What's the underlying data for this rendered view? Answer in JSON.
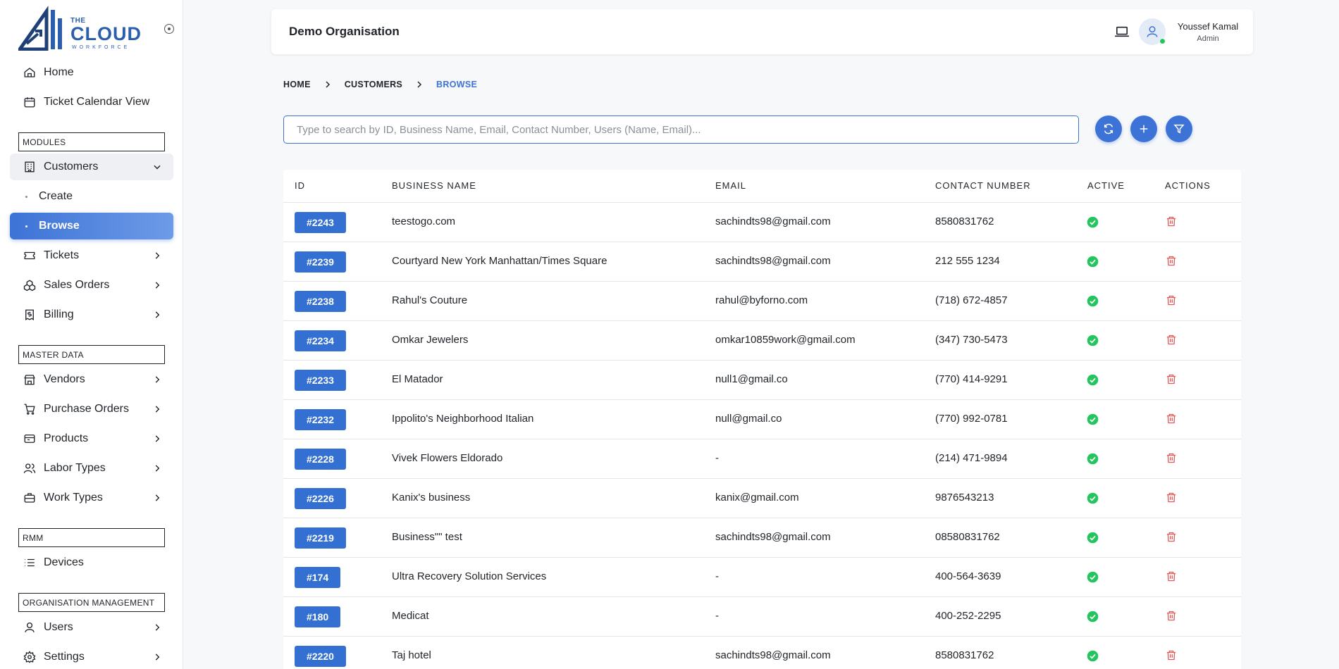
{
  "brand": {
    "top": "THE",
    "main": "CLOUD",
    "sub": "WORKFORCE"
  },
  "sidebar": {
    "items": [
      {
        "label": "Home",
        "icon": "home-icon"
      },
      {
        "label": "Ticket Calendar View",
        "icon": "calendar-icon"
      }
    ],
    "sections": [
      {
        "label": "MODULES"
      },
      {
        "label": "MASTER DATA"
      },
      {
        "label": "RMM"
      },
      {
        "label": "ORGANISATION MANAGEMENT"
      }
    ],
    "modules": [
      {
        "label": "Customers",
        "icon": "building-icon"
      },
      {
        "label": "Create"
      },
      {
        "label": "Browse"
      },
      {
        "label": "Tickets",
        "icon": "ticket-icon"
      },
      {
        "label": "Sales Orders",
        "icon": "boxes-icon"
      },
      {
        "label": "Billing",
        "icon": "receipt-icon"
      }
    ],
    "master_data": [
      {
        "label": "Vendors",
        "icon": "store-icon"
      },
      {
        "label": "Purchase Orders",
        "icon": "cart-icon"
      },
      {
        "label": "Products",
        "icon": "package-icon"
      },
      {
        "label": "Labor Types",
        "icon": "users-icon"
      },
      {
        "label": "Work Types",
        "icon": "briefcase-icon"
      }
    ],
    "rmm": [
      {
        "label": "Devices",
        "icon": "list-icon"
      }
    ],
    "org": [
      {
        "label": "Users",
        "icon": "user-icon"
      },
      {
        "label": "Settings",
        "icon": "gear-icon"
      }
    ]
  },
  "header": {
    "org_name": "Demo Organisation",
    "user_name": "Youssef Kamal",
    "user_role": "Admin"
  },
  "breadcrumb": [
    "HOME",
    "CUSTOMERS",
    "BROWSE"
  ],
  "search": {
    "placeholder": "Type to search by ID, Business Name, Email, Contact Number, Users (Name, Email)...",
    "value": ""
  },
  "table": {
    "columns": [
      "ID",
      "BUSINESS NAME",
      "EMAIL",
      "CONTACT NUMBER",
      "ACTIVE",
      "ACTIONS"
    ],
    "rows": [
      {
        "id": "#2243",
        "name": "teestogo.com",
        "email": "sachindts98@gmail.com",
        "phone": "8580831762",
        "active": true
      },
      {
        "id": "#2239",
        "name": "Courtyard New York Manhattan/Times Square",
        "email": "sachindts98@gmail.com",
        "phone": "212 555 1234",
        "active": true
      },
      {
        "id": "#2238",
        "name": "Rahul's Couture",
        "email": "rahul@byforno.com",
        "phone": "(718) 672-4857",
        "active": true
      },
      {
        "id": "#2234",
        "name": "Omkar Jewelers",
        "email": "omkar10859work@gmail.com",
        "phone": "(347) 730-5473",
        "active": true
      },
      {
        "id": "#2233",
        "name": "El Matador",
        "email": "null1@gmail.co",
        "phone": "(770) 414-9291",
        "active": true
      },
      {
        "id": "#2232",
        "name": "Ippolito's Neighborhood Italian",
        "email": "null@gmail.co",
        "phone": "(770) 992-0781",
        "active": true
      },
      {
        "id": "#2228",
        "name": "Vivek Flowers Eldorado",
        "email": "-",
        "phone": "(214) 471-9894",
        "active": true
      },
      {
        "id": "#2226",
        "name": "Kanix's business",
        "email": "kanix@gmail.com",
        "phone": "9876543213",
        "active": true
      },
      {
        "id": "#2219",
        "name": "Business\"\" test",
        "email": "sachindts98@gmail.com",
        "phone": "08580831762",
        "active": true
      },
      {
        "id": "#174",
        "name": "Ultra Recovery Solution Services",
        "email": "-",
        "phone": "400-564-3639",
        "active": true
      },
      {
        "id": "#180",
        "name": "Medicat",
        "email": "-",
        "phone": "400-252-2295",
        "active": true
      },
      {
        "id": "#2220",
        "name": "Taj hotel",
        "email": "sachindts98@gmail.com",
        "phone": "8580831762",
        "active": true
      }
    ]
  },
  "colors": {
    "accent": "#3d73d6",
    "success": "#22c55e",
    "danger": "#e05a5a"
  }
}
